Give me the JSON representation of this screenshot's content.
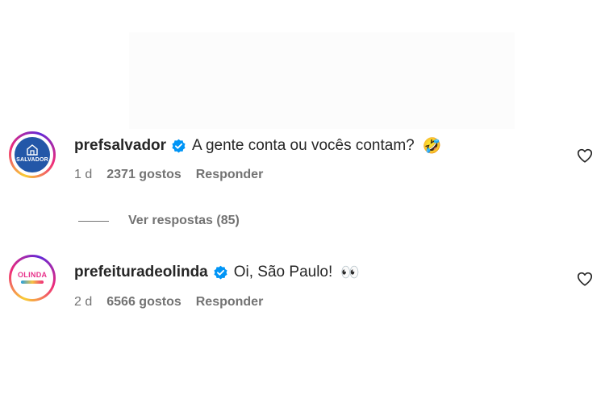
{
  "comments": [
    {
      "username": "prefsalvador",
      "avatar_text": "SALVADOR",
      "text": "A gente conta ou vocês contam?",
      "emoji": "🤣",
      "age": "1 d",
      "likes": "2371 gostos",
      "reply_label": "Responder",
      "view_replies": "Ver respostas (85)"
    },
    {
      "username": "prefeituradeolinda",
      "avatar_text": "OLINDA",
      "text": "Oi, São Paulo!",
      "emoji": "👀",
      "age": "2 d",
      "likes": "6566 gostos",
      "reply_label": "Responder"
    }
  ],
  "colors": {
    "verified": "#0095f6",
    "secondary_text": "#737373",
    "primary_text": "#262626"
  },
  "icons": {
    "verified": "verified-badge-icon",
    "like": "heart-outline-icon"
  }
}
